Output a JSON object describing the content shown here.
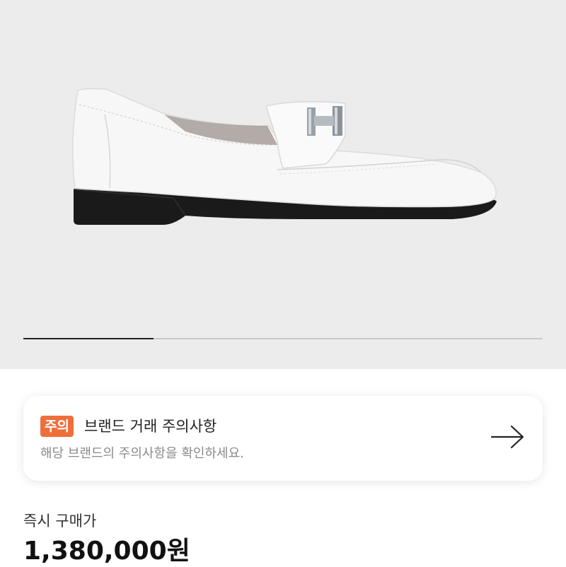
{
  "gallery": {
    "image_name": "white-loafer-product-photo",
    "progress_fraction": 0.25
  },
  "notice": {
    "badge": "주의",
    "title": "브랜드 거래 주의사항",
    "subtitle": "해당 브랜드의 주의사항을 확인하세요.",
    "icon": "arrow-right-icon"
  },
  "price": {
    "label": "즉시 구매가",
    "value": "1,380,000원"
  },
  "colors": {
    "badge": "#ef6f3c",
    "gallery_bg": "#ececec"
  }
}
